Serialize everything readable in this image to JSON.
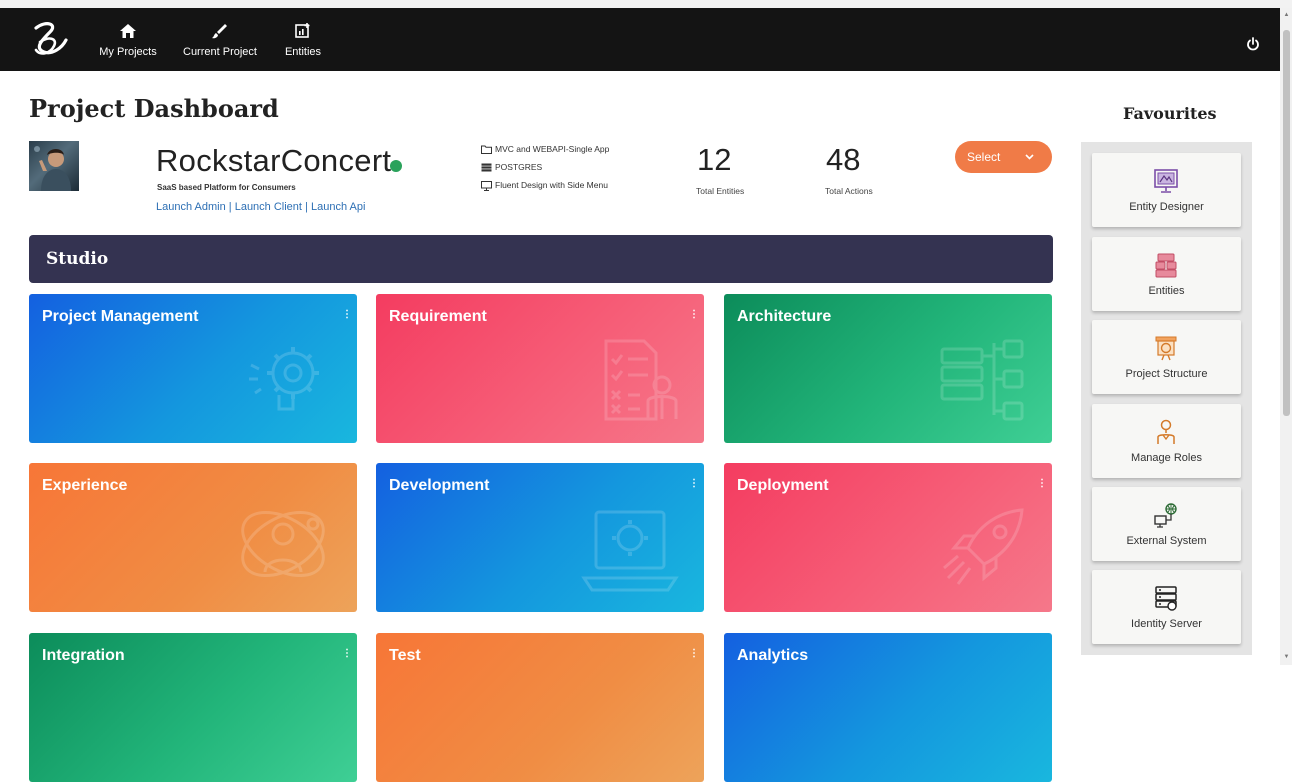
{
  "nav": {
    "items": [
      {
        "label": "My Projects",
        "icon": "home-icon"
      },
      {
        "label": "Current Project",
        "icon": "brush-icon"
      },
      {
        "label": "Entities",
        "icon": "entities-icon"
      }
    ],
    "power_icon": "power-icon"
  },
  "page": {
    "title": "Project Dashboard"
  },
  "project": {
    "name": "RockstarConcert",
    "status_color": "#2aa25b",
    "subtitle": "SaaS based Platform for Consumers",
    "links": [
      "Launch Admin",
      "Launch Client",
      "Launch Api"
    ],
    "link_separator": "|",
    "meta": [
      {
        "icon": "folder-icon",
        "text": "MVC and WEBAPI-Single App"
      },
      {
        "icon": "database-icon",
        "text": "POSTGRES"
      },
      {
        "icon": "monitor-icon",
        "text": "Fluent Design with Side Menu"
      }
    ],
    "stats": [
      {
        "value": "12",
        "label": "Total Entities"
      },
      {
        "value": "48",
        "label": "Total Actions"
      }
    ],
    "select_label": "Select"
  },
  "studio": {
    "title": "Studio",
    "cards": [
      {
        "title": "Project Management",
        "icon": "gear-bulb-icon",
        "kebab": "⋮"
      },
      {
        "title": "Requirement",
        "icon": "checklist-icon",
        "kebab": "⋮"
      },
      {
        "title": "Architecture",
        "icon": "server-tree-icon",
        "kebab": ""
      },
      {
        "title": "Experience",
        "icon": "user-orbit-icon",
        "kebab": ""
      },
      {
        "title": "Development",
        "icon": "laptop-gear-icon",
        "kebab": "⋮"
      },
      {
        "title": "Deployment",
        "icon": "rocket-icon",
        "kebab": "⋮"
      },
      {
        "title": "Integration",
        "icon": "integration-icon",
        "kebab": "⋮"
      },
      {
        "title": "Test",
        "icon": "test-icon",
        "kebab": "⋮"
      },
      {
        "title": "Analytics",
        "icon": "analytics-icon",
        "kebab": ""
      }
    ]
  },
  "favourites": {
    "title": "Favourites",
    "items": [
      {
        "label": "Entity Designer",
        "icon": "entity-designer-icon"
      },
      {
        "label": "Entities",
        "icon": "entities-grid-icon"
      },
      {
        "label": "Project Structure",
        "icon": "project-structure-icon"
      },
      {
        "label": "Manage Roles",
        "icon": "manage-roles-icon"
      },
      {
        "label": "External System",
        "icon": "external-system-icon"
      },
      {
        "label": "Identity Server",
        "icon": "identity-server-icon"
      }
    ]
  },
  "colors": {
    "topbar": "#141414",
    "studio_bar": "#343351",
    "accent_orange": "#f07b47",
    "link_blue": "#2d6fb4"
  }
}
